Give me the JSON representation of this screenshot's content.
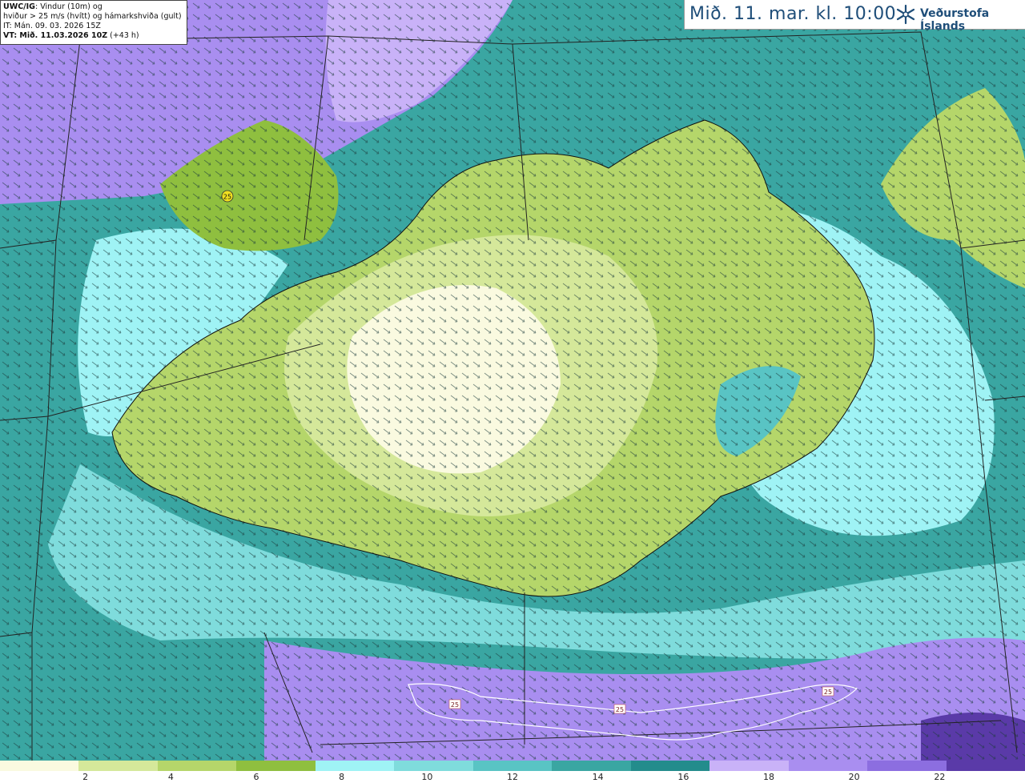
{
  "info": {
    "line1_bold": "UWC/IG",
    "line1_rest": ": Vindur (10m) og",
    "line2": "hviður > 25 m/s (hvítt) og hámarkshviða (gult)",
    "line3": "IT: Mán. 09. 03. 2026 15Z",
    "line4_bold": "VT: Mið. 11.03.2026 10Z",
    "line4_rest": " (+43 h)"
  },
  "title": "Mið. 11. mar. kl. 10:00",
  "brand": "Veðurstofa Íslands",
  "brand_icon": "snowflake-logo-icon",
  "gust_labels": [
    "25",
    "25",
    "25",
    "25"
  ],
  "scale": {
    "colors": [
      "#fafae0",
      "#d5e89a",
      "#b5d66a",
      "#8fbf3f",
      "#9ff3f5",
      "#7fdcdc",
      "#59c4c4",
      "#3aa6a2",
      "#238c8c",
      "#c9b2f8",
      "#a98ef0",
      "#8c6ee0",
      "#5a3aa8"
    ],
    "labels": [
      "2",
      "4",
      "6",
      "8",
      "10",
      "12",
      "14",
      "16",
      "18",
      "20",
      "22"
    ]
  },
  "colors": {
    "land_low": "#fafae0",
    "land_mid": "#b5d66a",
    "land_high": "#8fbf3f",
    "sea_teal": "#3aa6a2",
    "sea_light": "#9ff3f5",
    "sea_purple": "#a98ef0"
  }
}
